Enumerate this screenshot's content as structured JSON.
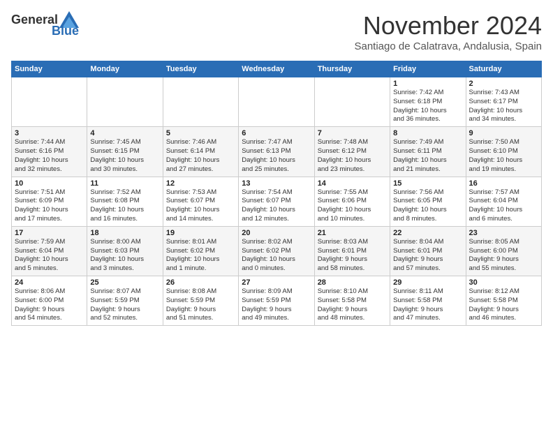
{
  "logo": {
    "text_general": "General",
    "text_blue": "Blue"
  },
  "header": {
    "month": "November 2024",
    "location": "Santiago de Calatrava, Andalusia, Spain"
  },
  "weekdays": [
    "Sunday",
    "Monday",
    "Tuesday",
    "Wednesday",
    "Thursday",
    "Friday",
    "Saturday"
  ],
  "weeks": [
    [
      {
        "day": "",
        "info": ""
      },
      {
        "day": "",
        "info": ""
      },
      {
        "day": "",
        "info": ""
      },
      {
        "day": "",
        "info": ""
      },
      {
        "day": "",
        "info": ""
      },
      {
        "day": "1",
        "info": "Sunrise: 7:42 AM\nSunset: 6:18 PM\nDaylight: 10 hours\nand 36 minutes."
      },
      {
        "day": "2",
        "info": "Sunrise: 7:43 AM\nSunset: 6:17 PM\nDaylight: 10 hours\nand 34 minutes."
      }
    ],
    [
      {
        "day": "3",
        "info": "Sunrise: 7:44 AM\nSunset: 6:16 PM\nDaylight: 10 hours\nand 32 minutes."
      },
      {
        "day": "4",
        "info": "Sunrise: 7:45 AM\nSunset: 6:15 PM\nDaylight: 10 hours\nand 30 minutes."
      },
      {
        "day": "5",
        "info": "Sunrise: 7:46 AM\nSunset: 6:14 PM\nDaylight: 10 hours\nand 27 minutes."
      },
      {
        "day": "6",
        "info": "Sunrise: 7:47 AM\nSunset: 6:13 PM\nDaylight: 10 hours\nand 25 minutes."
      },
      {
        "day": "7",
        "info": "Sunrise: 7:48 AM\nSunset: 6:12 PM\nDaylight: 10 hours\nand 23 minutes."
      },
      {
        "day": "8",
        "info": "Sunrise: 7:49 AM\nSunset: 6:11 PM\nDaylight: 10 hours\nand 21 minutes."
      },
      {
        "day": "9",
        "info": "Sunrise: 7:50 AM\nSunset: 6:10 PM\nDaylight: 10 hours\nand 19 minutes."
      }
    ],
    [
      {
        "day": "10",
        "info": "Sunrise: 7:51 AM\nSunset: 6:09 PM\nDaylight: 10 hours\nand 17 minutes."
      },
      {
        "day": "11",
        "info": "Sunrise: 7:52 AM\nSunset: 6:08 PM\nDaylight: 10 hours\nand 16 minutes."
      },
      {
        "day": "12",
        "info": "Sunrise: 7:53 AM\nSunset: 6:07 PM\nDaylight: 10 hours\nand 14 minutes."
      },
      {
        "day": "13",
        "info": "Sunrise: 7:54 AM\nSunset: 6:07 PM\nDaylight: 10 hours\nand 12 minutes."
      },
      {
        "day": "14",
        "info": "Sunrise: 7:55 AM\nSunset: 6:06 PM\nDaylight: 10 hours\nand 10 minutes."
      },
      {
        "day": "15",
        "info": "Sunrise: 7:56 AM\nSunset: 6:05 PM\nDaylight: 10 hours\nand 8 minutes."
      },
      {
        "day": "16",
        "info": "Sunrise: 7:57 AM\nSunset: 6:04 PM\nDaylight: 10 hours\nand 6 minutes."
      }
    ],
    [
      {
        "day": "17",
        "info": "Sunrise: 7:59 AM\nSunset: 6:04 PM\nDaylight: 10 hours\nand 5 minutes."
      },
      {
        "day": "18",
        "info": "Sunrise: 8:00 AM\nSunset: 6:03 PM\nDaylight: 10 hours\nand 3 minutes."
      },
      {
        "day": "19",
        "info": "Sunrise: 8:01 AM\nSunset: 6:02 PM\nDaylight: 10 hours\nand 1 minute."
      },
      {
        "day": "20",
        "info": "Sunrise: 8:02 AM\nSunset: 6:02 PM\nDaylight: 10 hours\nand 0 minutes."
      },
      {
        "day": "21",
        "info": "Sunrise: 8:03 AM\nSunset: 6:01 PM\nDaylight: 9 hours\nand 58 minutes."
      },
      {
        "day": "22",
        "info": "Sunrise: 8:04 AM\nSunset: 6:01 PM\nDaylight: 9 hours\nand 57 minutes."
      },
      {
        "day": "23",
        "info": "Sunrise: 8:05 AM\nSunset: 6:00 PM\nDaylight: 9 hours\nand 55 minutes."
      }
    ],
    [
      {
        "day": "24",
        "info": "Sunrise: 8:06 AM\nSunset: 6:00 PM\nDaylight: 9 hours\nand 54 minutes."
      },
      {
        "day": "25",
        "info": "Sunrise: 8:07 AM\nSunset: 5:59 PM\nDaylight: 9 hours\nand 52 minutes."
      },
      {
        "day": "26",
        "info": "Sunrise: 8:08 AM\nSunset: 5:59 PM\nDaylight: 9 hours\nand 51 minutes."
      },
      {
        "day": "27",
        "info": "Sunrise: 8:09 AM\nSunset: 5:59 PM\nDaylight: 9 hours\nand 49 minutes."
      },
      {
        "day": "28",
        "info": "Sunrise: 8:10 AM\nSunset: 5:58 PM\nDaylight: 9 hours\nand 48 minutes."
      },
      {
        "day": "29",
        "info": "Sunrise: 8:11 AM\nSunset: 5:58 PM\nDaylight: 9 hours\nand 47 minutes."
      },
      {
        "day": "30",
        "info": "Sunrise: 8:12 AM\nSunset: 5:58 PM\nDaylight: 9 hours\nand 46 minutes."
      }
    ]
  ]
}
